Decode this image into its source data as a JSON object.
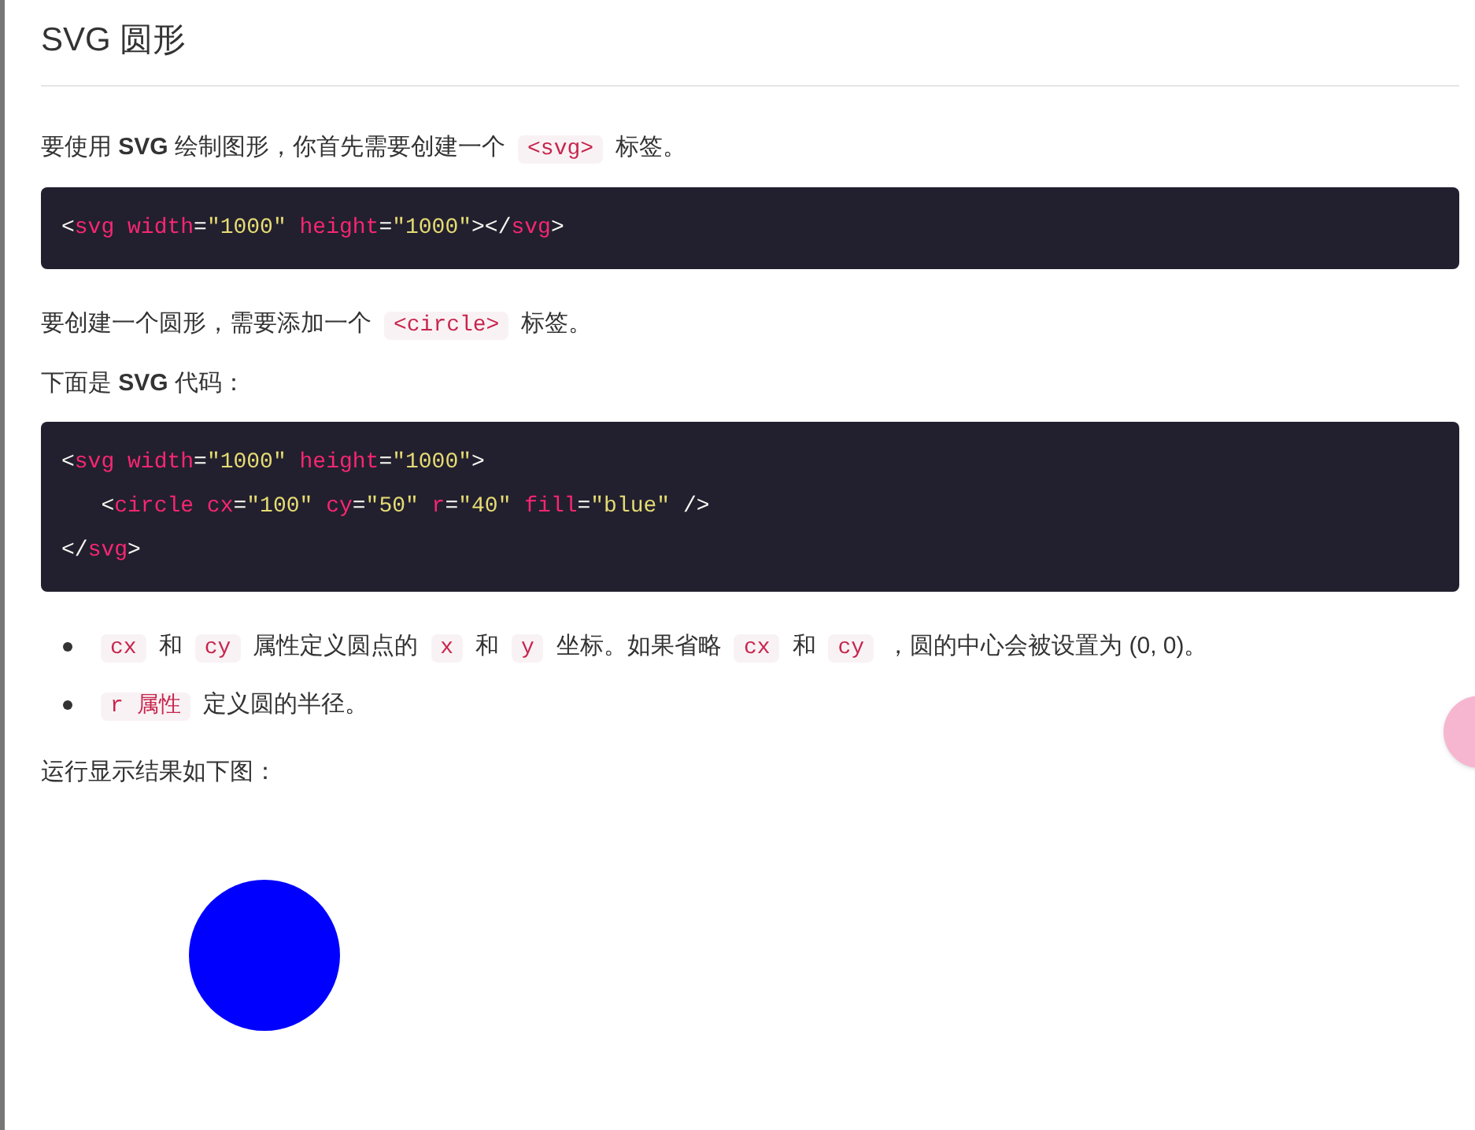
{
  "heading": "SVG 圆形",
  "blocks": [
    {
      "kind": "paragraph",
      "segments": [
        {
          "kind": "text",
          "text": "要使用 **SVG** 绘制图形，你首先需要创建一个"
        },
        {
          "kind": "code",
          "text": "<svg>"
        },
        {
          "kind": "text",
          "text": "标签。"
        }
      ]
    },
    {
      "kind": "codeblock",
      "lines": [
        [
          {
            "kind": "punct",
            "text": "<"
          },
          {
            "kind": "tag",
            "text": "svg"
          },
          {
            "kind": "attr",
            "text": " width"
          },
          {
            "kind": "punct",
            "text": "="
          },
          {
            "kind": "string",
            "text": "\"1000\""
          },
          {
            "kind": "attr",
            "text": " height"
          },
          {
            "kind": "punct",
            "text": "="
          },
          {
            "kind": "string",
            "text": "\"1000\""
          },
          {
            "kind": "punct",
            "text": "></"
          },
          {
            "kind": "tag",
            "text": "svg"
          },
          {
            "kind": "punct",
            "text": ">"
          }
        ]
      ]
    },
    {
      "kind": "paragraph",
      "segments": [
        {
          "kind": "text",
          "text": "要创建一个圆形，需要添加一个"
        },
        {
          "kind": "code",
          "text": "<circle>"
        },
        {
          "kind": "text",
          "text": "标签。"
        }
      ]
    },
    {
      "kind": "paragraph",
      "segments": [
        {
          "kind": "text",
          "text": "下面是 **SVG** 代码："
        }
      ]
    },
    {
      "kind": "codeblock",
      "lines": [
        [
          {
            "kind": "punct",
            "text": "<"
          },
          {
            "kind": "tag",
            "text": "svg"
          },
          {
            "kind": "attr",
            "text": " width"
          },
          {
            "kind": "punct",
            "text": "="
          },
          {
            "kind": "string",
            "text": "\"1000\""
          },
          {
            "kind": "attr",
            "text": " height"
          },
          {
            "kind": "punct",
            "text": "="
          },
          {
            "kind": "string",
            "text": "\"1000\""
          },
          {
            "kind": "punct",
            "text": ">"
          }
        ],
        [
          {
            "kind": "punct",
            "text": "   <"
          },
          {
            "kind": "tag",
            "text": "circle"
          },
          {
            "kind": "attr",
            "text": " cx"
          },
          {
            "kind": "punct",
            "text": "="
          },
          {
            "kind": "string",
            "text": "\"100\""
          },
          {
            "kind": "attr",
            "text": " cy"
          },
          {
            "kind": "punct",
            "text": "="
          },
          {
            "kind": "string",
            "text": "\"50\""
          },
          {
            "kind": "attr",
            "text": " r"
          },
          {
            "kind": "punct",
            "text": "="
          },
          {
            "kind": "string",
            "text": "\"40\""
          },
          {
            "kind": "attr",
            "text": " fill"
          },
          {
            "kind": "punct",
            "text": "="
          },
          {
            "kind": "string",
            "text": "\"blue\""
          },
          {
            "kind": "punct",
            "text": " />"
          }
        ],
        [
          {
            "kind": "punct",
            "text": "</"
          },
          {
            "kind": "tag",
            "text": "svg"
          },
          {
            "kind": "punct",
            "text": ">"
          }
        ]
      ]
    },
    {
      "kind": "bullets",
      "items": [
        [
          {
            "kind": "code",
            "text": "cx"
          },
          {
            "kind": "text",
            "text": "和"
          },
          {
            "kind": "code",
            "text": "cy"
          },
          {
            "kind": "text",
            "text": "属性定义圆点的"
          },
          {
            "kind": "code",
            "text": "x"
          },
          {
            "kind": "text",
            "text": "和"
          },
          {
            "kind": "code",
            "text": "y"
          },
          {
            "kind": "text",
            "text": "坐标。如果省略"
          },
          {
            "kind": "code",
            "text": "cx"
          },
          {
            "kind": "text",
            "text": "和"
          },
          {
            "kind": "code",
            "text": "cy"
          },
          {
            "kind": "text",
            "text": "，圆的中心会被设置为 (0, 0)。"
          }
        ],
        [
          {
            "kind": "code",
            "text": "r 属性"
          },
          {
            "kind": "text",
            "text": "定义圆的半径。"
          }
        ]
      ]
    },
    {
      "kind": "paragraph",
      "segments": [
        {
          "kind": "text",
          "text": "运行显示结果如下图："
        }
      ]
    },
    {
      "kind": "result"
    }
  ]
}
